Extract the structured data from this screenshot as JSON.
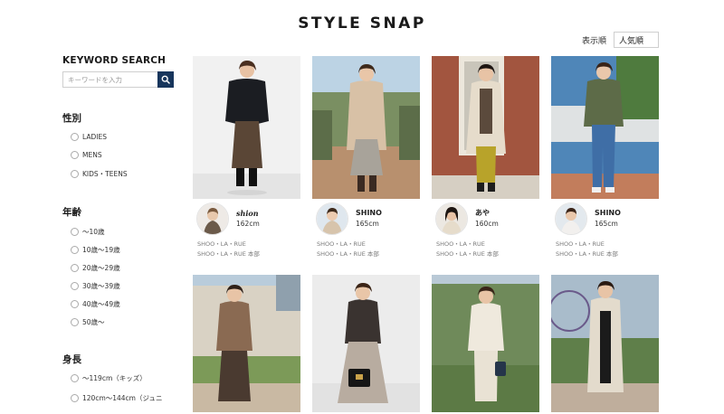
{
  "page": {
    "title": "STYLE SNAP"
  },
  "sort": {
    "label": "表示順",
    "value": "人気順"
  },
  "search": {
    "title": "KEYWORD SEARCH",
    "placeholder": "キーワードを入力"
  },
  "filters": {
    "gender": {
      "title": "性別",
      "options": [
        "LADIES",
        "MENS",
        "KIDS・TEENS"
      ]
    },
    "age": {
      "title": "年齢",
      "options": [
        "〜10歳",
        "10歳〜19歳",
        "20歳〜29歳",
        "30歳〜39歳",
        "40歳〜49歳",
        "50歳〜"
      ]
    },
    "height": {
      "title": "身長",
      "options": [
        "〜119cm（キッズ）",
        "120cm〜144cm（ジュニ"
      ]
    }
  },
  "snaps": [
    {
      "name": "shion",
      "height": "162cm",
      "shop": "SHOO・LA・RUE",
      "store": "SHOO・LA・RUE 本部"
    },
    {
      "name": "SHINO",
      "height": "165cm",
      "shop": "SHOO・LA・RUE",
      "store": "SHOO・LA・RUE 本部"
    },
    {
      "name": "あや",
      "height": "160cm",
      "shop": "SHOO・LA・RUE",
      "store": "SHOO・LA・RUE 本部"
    },
    {
      "name": "SHINO",
      "height": "165cm",
      "shop": "SHOO・LA・RUE",
      "store": "SHOO・LA・RUE 本部"
    }
  ],
  "icons": {
    "search": "search-icon"
  },
  "colors": {
    "search_button": "#17355c",
    "text": "#222222",
    "muted": "#7a7a7a"
  }
}
